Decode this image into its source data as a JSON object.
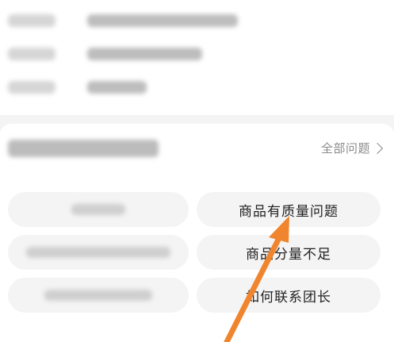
{
  "questions": {
    "view_all_label": "全部问题",
    "items": [
      {
        "label": "商品有质量问题"
      },
      {
        "label": "商品分量不足"
      },
      {
        "label": "如何联系团长"
      }
    ]
  },
  "colors": {
    "pill_bg": "#f4f4f4",
    "arrow": "#f0852e",
    "link_text": "#8a8a8a"
  },
  "icons": {
    "view_all": "chevron-right-icon",
    "annotation": "arrow-annotation-icon"
  }
}
